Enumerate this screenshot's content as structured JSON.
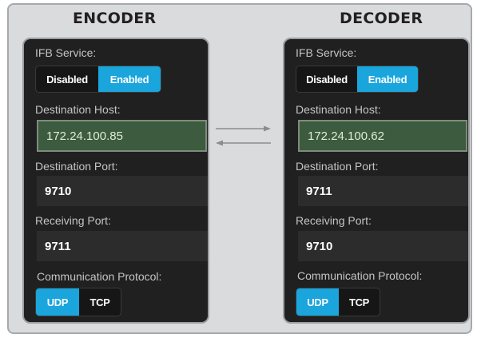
{
  "encoder": {
    "heading": "ENCODER",
    "ifb_label": "IFB Service:",
    "ifb_options": [
      "Disabled",
      "Enabled"
    ],
    "ifb_selected": "Enabled",
    "dest_host_label": "Destination Host:",
    "dest_host_value": "172.24.100.85",
    "dest_port_label": "Destination Port:",
    "dest_port_value": "9710",
    "recv_port_label": "Receiving Port:",
    "recv_port_value": "9711",
    "protocol_label": "Communication Protocol:",
    "protocol_options": [
      "UDP",
      "TCP"
    ],
    "protocol_selected": "UDP"
  },
  "decoder": {
    "heading": "DECODER",
    "ifb_label": "IFB Service:",
    "ifb_options": [
      "Disabled",
      "Enabled"
    ],
    "ifb_selected": "Enabled",
    "dest_host_label": "Destination Host:",
    "dest_host_value": "172.24.100.62",
    "dest_port_label": "Destination Port:",
    "dest_port_value": "9711",
    "recv_port_label": "Receiving Port:",
    "recv_port_value": "9710",
    "protocol_label": "Communication Protocol:",
    "protocol_options": [
      "UDP",
      "TCP"
    ],
    "protocol_selected": "UDP"
  },
  "colors": {
    "accent": "#1aa5dc",
    "panel_bg": "#202020",
    "host_field_bg": "#3d5b3e",
    "frame_bg": "#d9dbdd"
  }
}
